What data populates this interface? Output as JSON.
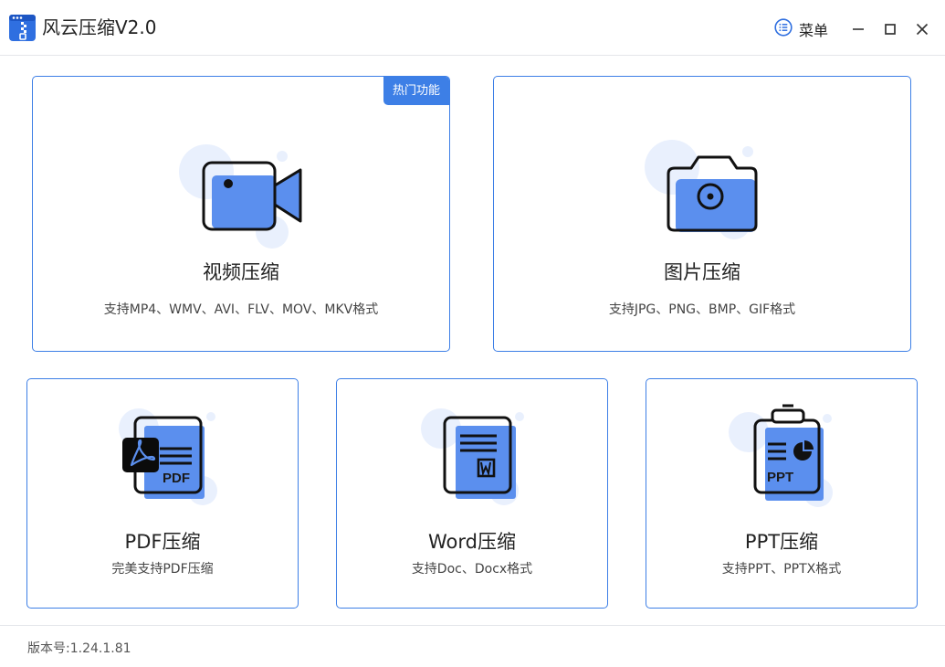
{
  "app": {
    "title": "风云压缩V2.0",
    "menu_label": "菜单"
  },
  "colors": {
    "accent": "#3d7fe6",
    "icon_fill": "#5b8fee",
    "icon_bg_circle": "#e9f0fd"
  },
  "cards": {
    "video": {
      "title": "视频压缩",
      "desc": "支持MP4、WMV、AVI、FLV、MOV、MKV格式",
      "badge": "热门功能",
      "icon": "video-camera-icon"
    },
    "image": {
      "title": "图片压缩",
      "desc": "支持JPG、PNG、BMP、GIF格式",
      "icon": "camera-icon"
    },
    "pdf": {
      "title": "PDF压缩",
      "desc": "完美支持PDF压缩",
      "icon": "pdf-document-icon",
      "icon_text": "PDF"
    },
    "word": {
      "title": "Word压缩",
      "desc": "支持Doc、Docx格式",
      "icon": "word-document-icon"
    },
    "ppt": {
      "title": "PPT压缩",
      "desc": "支持PPT、PPTX格式",
      "icon": "ppt-document-icon",
      "icon_text": "PPT"
    }
  },
  "footer": {
    "version": "版本号:1.24.1.81"
  }
}
